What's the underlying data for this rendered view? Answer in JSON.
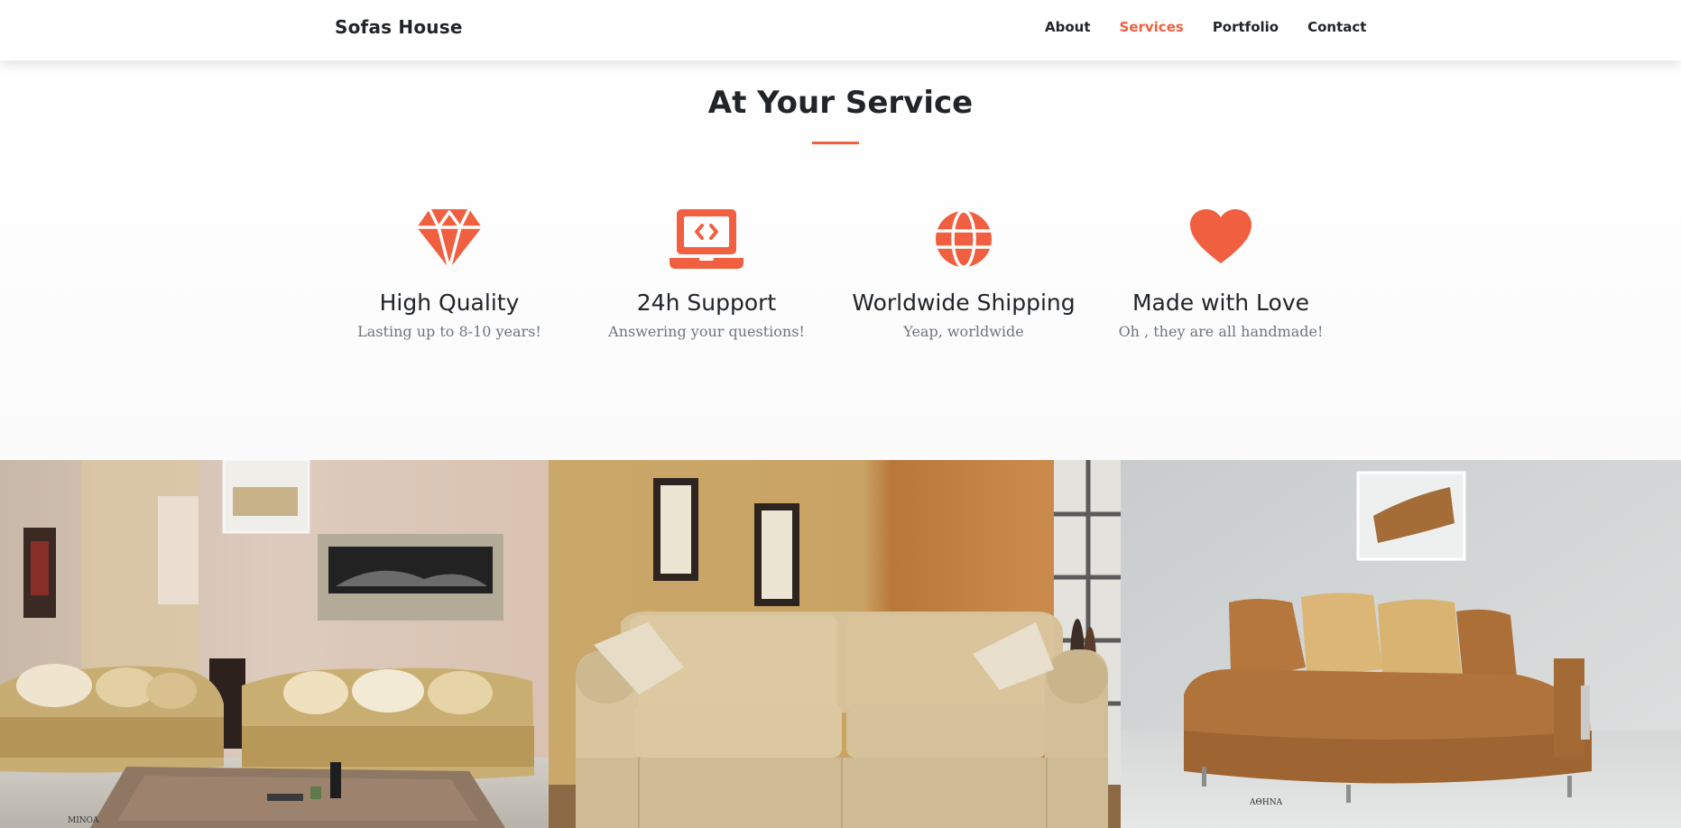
{
  "nav": {
    "brand": "Sofas House",
    "links": [
      {
        "label": "About",
        "active": false
      },
      {
        "label": "Services",
        "active": true
      },
      {
        "label": "Portfolio",
        "active": false
      },
      {
        "label": "Contact",
        "active": false
      }
    ]
  },
  "services": {
    "title": "At Your Service",
    "items": [
      {
        "icon": "gem-icon",
        "title": "High Quality",
        "text": "Lasting up to 8-10 years!"
      },
      {
        "icon": "laptop-code-icon",
        "title": "24h Support",
        "text": "Answering your questions!"
      },
      {
        "icon": "globe-icon",
        "title": "Worldwide Shipping",
        "text": "Yeap, worldwide"
      },
      {
        "icon": "heart-icon",
        "title": "Made with Love",
        "text": "Oh , they are all handmade!"
      }
    ]
  },
  "portfolio": {
    "images": [
      {
        "name": "portfolio-image-living-room-sofas",
        "caption": "MINOA"
      },
      {
        "name": "portfolio-image-beige-sofa"
      },
      {
        "name": "portfolio-image-brown-sofa",
        "caption": "ΑΘΗΝΑ"
      }
    ]
  },
  "colors": {
    "accent": "#f05f40",
    "text": "#212529",
    "muted": "#6c757d"
  }
}
